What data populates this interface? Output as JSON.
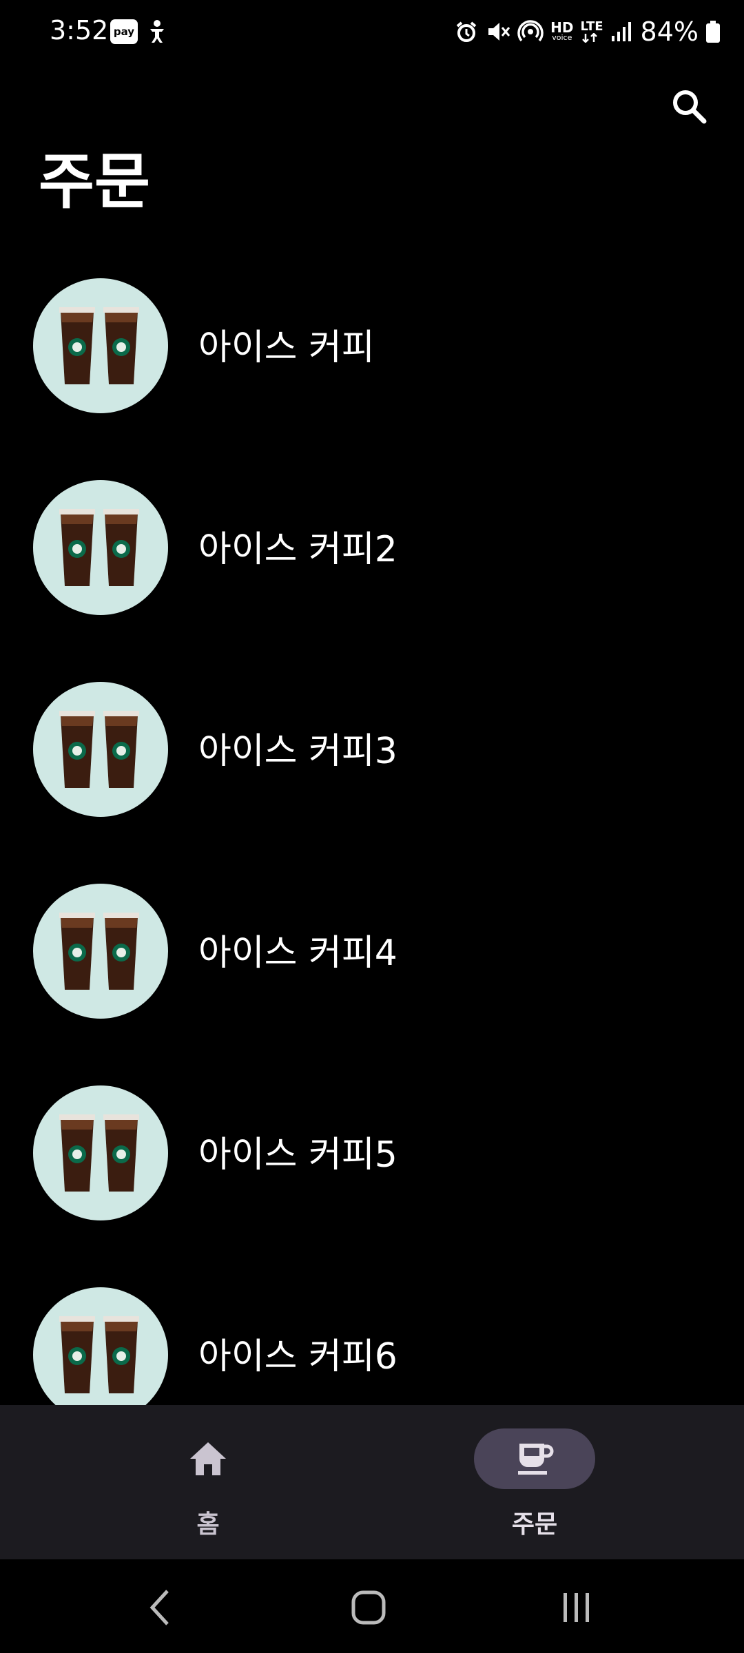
{
  "status_bar": {
    "time": "3:52",
    "pay_badge": "pay",
    "hd_label": "HD",
    "hd_sub": "voice",
    "lte_label": "LTE",
    "battery": "84%",
    "icons": [
      "alarm-icon",
      "mute-icon",
      "hotspot-icon",
      "signal-icon",
      "battery-icon"
    ]
  },
  "app_bar": {
    "title": "주문",
    "search_icon": "search-icon"
  },
  "menu": {
    "items": [
      {
        "label": "아이스 커피"
      },
      {
        "label": "아이스 커피2"
      },
      {
        "label": "아이스 커피3"
      },
      {
        "label": "아이스 커피4"
      },
      {
        "label": "아이스 커피5"
      },
      {
        "label": "아이스 커피6"
      }
    ],
    "thumbnail_bg": "#cfe8e4"
  },
  "bottom_nav": {
    "items": [
      {
        "label": "홈",
        "icon": "home-icon",
        "selected": false
      },
      {
        "label": "주문",
        "icon": "coffee-cup-icon",
        "selected": true
      }
    ],
    "background": "#1c1b20",
    "indicator": "#4a4458"
  },
  "system_nav": {
    "buttons": [
      "back-icon",
      "home-circle-icon",
      "recents-icon"
    ]
  }
}
